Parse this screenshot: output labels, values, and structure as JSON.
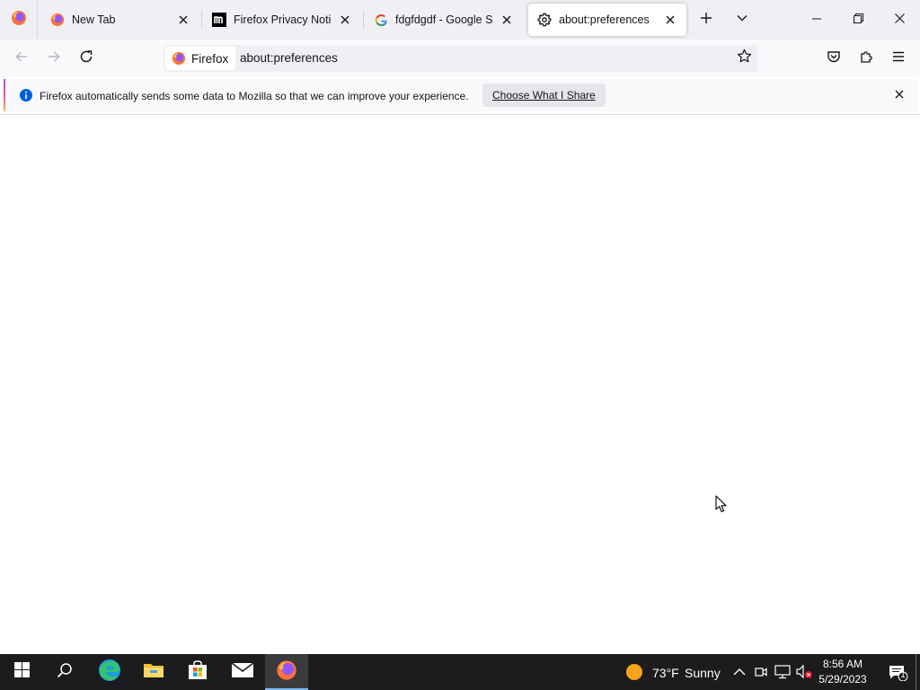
{
  "tabs": [
    {
      "title": "New Tab",
      "icon": "firefox-logo-icon",
      "active": false
    },
    {
      "title": "Firefox Privacy Notice —",
      "icon": "mozilla-m-icon",
      "active": false
    },
    {
      "title": "fdgfdgdf - Google Search",
      "icon": "google-g-icon",
      "active": false
    },
    {
      "title": "about:preferences",
      "icon": "gear-icon",
      "active": true
    }
  ],
  "tabstrip": {
    "new_tab": "plus-icon",
    "list_all_tabs": "chevron-down-icon"
  },
  "window_controls": [
    "minimize-icon",
    "restore-icon",
    "close-icon"
  ],
  "navbar": {
    "identity_label": "Firefox",
    "url": "about:preferences",
    "bookmark": "star-icon"
  },
  "toolbar_right": [
    "pocket-icon",
    "extensions-icon",
    "hamburger-menu-icon"
  ],
  "notification": {
    "message": "Firefox automatically sends some data to Mozilla so that we can improve your experience.",
    "button_label": "Choose What I Share"
  },
  "taskbar": {
    "apps": [
      "windows-start-icon",
      "search-icon",
      "edge-icon",
      "file-explorer-icon",
      "store-icon",
      "mail-icon",
      "firefox-icon"
    ],
    "weather": {
      "temperature": "73°F",
      "condition": "Sunny"
    },
    "clock": {
      "time": "8:56 AM",
      "date": "5/29/2023"
    },
    "notification_count": "1"
  },
  "colors": {
    "tabstrip_bg": "#f0f0f4",
    "navbar_bg": "#f9f9fb",
    "taskbar_bg": "#1c1c1e",
    "info_blue": "#0060df"
  }
}
